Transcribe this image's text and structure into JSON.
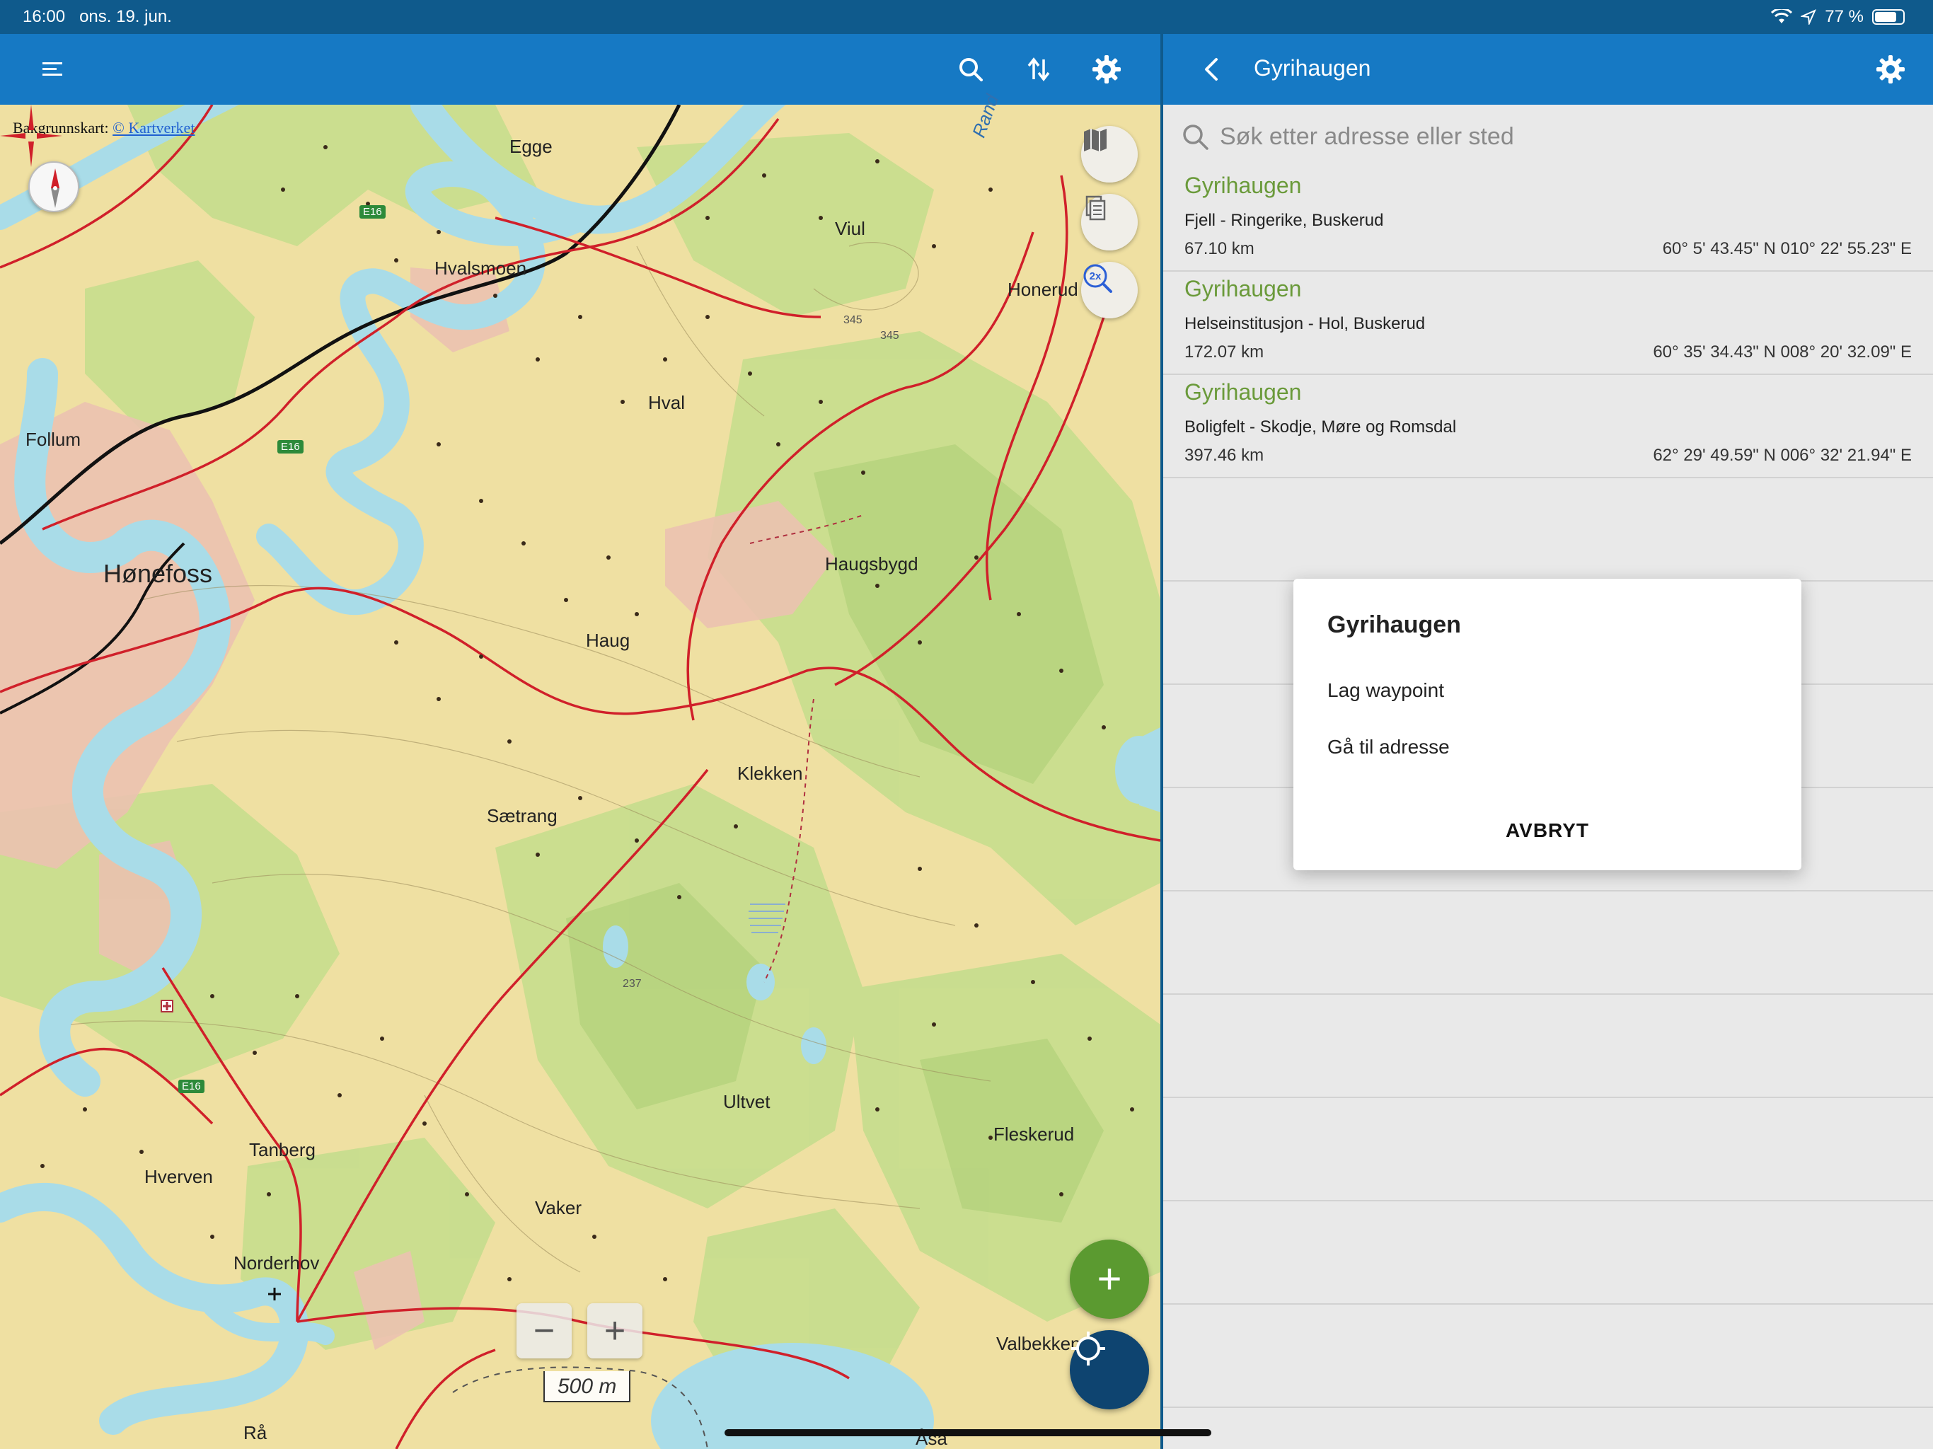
{
  "status_bar": {
    "time": "16:00",
    "date": "ons. 19. jun.",
    "battery_text": "77 %",
    "battery_level": 0.77
  },
  "map": {
    "attribution_prefix": "Bakgrunnskart:",
    "attribution_link": "© Kartverket",
    "places": {
      "egge": "Egge",
      "viul": "Viul",
      "hvalsmoen": "Hvalsmoen",
      "honerud": "Honerud",
      "follum": "Follum",
      "hval": "Hval",
      "honefoss": "Hønefoss",
      "haugsbygd": "Haugsbygd",
      "haug": "Haug",
      "klekken": "Klekken",
      "saetrang": "Sætrang",
      "ultvet": "Ultvet",
      "fleskerud": "Fleskerud",
      "tanberg": "Tanberg",
      "hverven": "Hverven",
      "vaker": "Vaker",
      "norderhov": "Norderhov",
      "valbekken": "Valbekken",
      "ra": "Rå",
      "asa": "Åsa",
      "randsfjorden": "Rand"
    },
    "road_signs": {
      "e16_a": "E16",
      "e16_b": "E16",
      "e16_c": "E16"
    },
    "elevations": {
      "e345_a": "345",
      "e345_b": "345",
      "e237": "237"
    },
    "zoom_in_label": "+",
    "zoom_out_label": "−",
    "scale_label": "500 m",
    "detail_button_label": "2x",
    "add_button_label": "+",
    "accent_green": "#5b9a30",
    "accent_navy": "#0e4470"
  },
  "side_panel": {
    "title": "Gyrihaugen",
    "search_placeholder": "Søk etter adresse eller sted",
    "results": [
      {
        "name": "Gyrihaugen",
        "type": "Fjell - Ringerike, Buskerud",
        "distance": "67.10 km",
        "coordinates": "60° 5' 43.45\" N 010° 22' 55.23\" E"
      },
      {
        "name": "Gyrihaugen",
        "type": "Helseinstitusjon - Hol, Buskerud",
        "distance": "172.07 km",
        "coordinates": "60° 35' 34.43\" N 008° 20' 32.09\" E"
      },
      {
        "name": "Gyrihaugen",
        "type": "Boligfelt - Skodje, Møre og Romsdal",
        "distance": "397.46 km",
        "coordinates": "62° 29' 49.59\" N 006° 32' 21.94\" E"
      }
    ]
  },
  "dialog": {
    "title": "Gyrihaugen",
    "option_waypoint": "Lag waypoint",
    "option_goto": "Gå til adresse",
    "cancel": "AVBRYT"
  },
  "colors": {
    "toolbar": "#1679c4",
    "status_bar": "#0f5a8c",
    "result_name": "#6a9a3a"
  }
}
